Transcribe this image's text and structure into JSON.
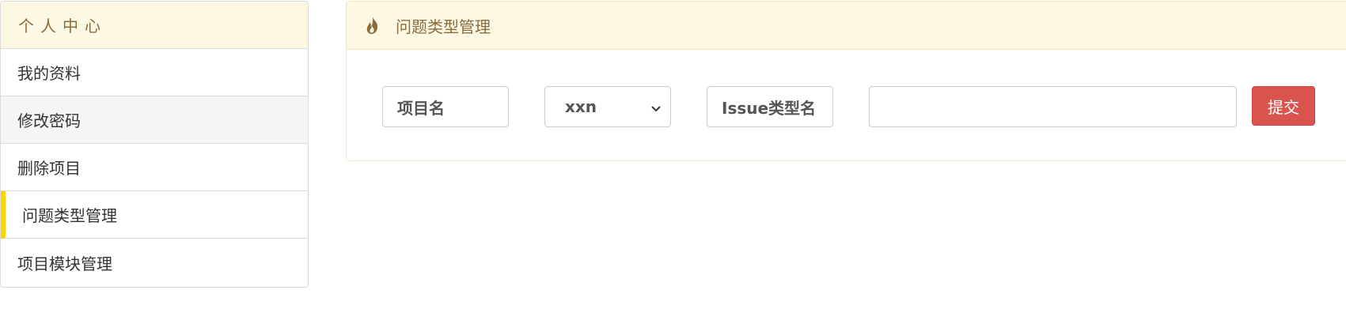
{
  "sidebar": {
    "title": "个人中心",
    "items": [
      {
        "label": "我的资料"
      },
      {
        "label": "修改密码"
      },
      {
        "label": "删除项目"
      },
      {
        "label": "问题类型管理"
      },
      {
        "label": "项目模块管理"
      }
    ]
  },
  "panel": {
    "title": "问题类型管理",
    "icon": "fire-icon",
    "form": {
      "project_label": "项目名",
      "project_select_value": "xxn",
      "issue_type_label": "Issue类型名",
      "issue_type_value": "",
      "submit_label": "提交"
    }
  },
  "colors": {
    "header_bg": "#fcf8e3",
    "header_text": "#8a6d3b",
    "active_indicator": "#ffd400",
    "submit_bg": "#d9534f"
  }
}
